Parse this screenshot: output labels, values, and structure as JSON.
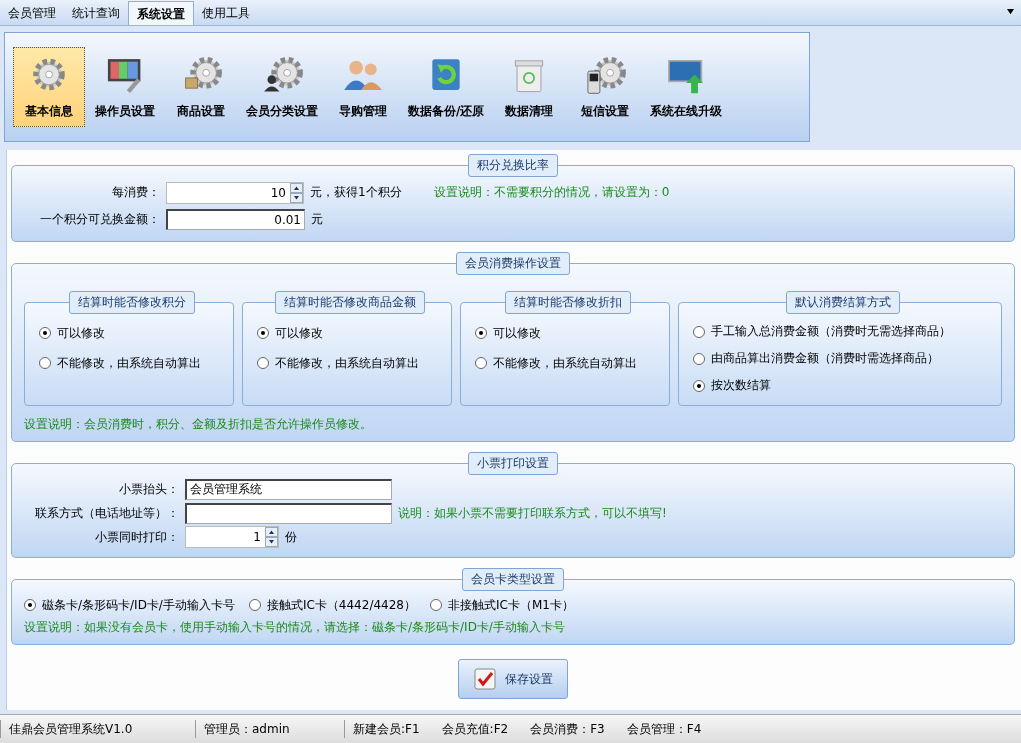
{
  "tabs": [
    {
      "label": "会员管理",
      "selected": false
    },
    {
      "label": "统计查询",
      "selected": false
    },
    {
      "label": "系统设置",
      "selected": true
    },
    {
      "label": "使用工具",
      "selected": false
    }
  ],
  "toolbar": [
    {
      "label": "基本信息",
      "selected": true
    },
    {
      "label": "操作员设置",
      "selected": false
    },
    {
      "label": "商品设置",
      "selected": false
    },
    {
      "label": "会员分类设置",
      "selected": false
    },
    {
      "label": "导购管理",
      "selected": false
    },
    {
      "label": "数据备份/还原",
      "selected": false
    },
    {
      "label": "数据清理",
      "selected": false
    },
    {
      "label": "短信设置",
      "selected": false
    },
    {
      "label": "系统在线升级",
      "selected": false
    }
  ],
  "points": {
    "title": "积分兑换比率",
    "spend_label": "每消费：",
    "spend_value": "10",
    "spend_suffix": "元，获得1个积分",
    "note": "设置说明：不需要积分的情况，请设置为：0",
    "exchange_label": "一个积分可兑换金额：",
    "exchange_value": "0.01",
    "exchange_suffix": "元"
  },
  "consume": {
    "title": "会员消费操作设置",
    "groups": [
      {
        "title": "结算时能否修改积分",
        "options": [
          {
            "label": "可以修改",
            "selected": true
          },
          {
            "label": "不能修改，由系统自动算出",
            "selected": false
          }
        ]
      },
      {
        "title": "结算时能否修改商品金额",
        "options": [
          {
            "label": "可以修改",
            "selected": true
          },
          {
            "label": "不能修改，由系统自动算出",
            "selected": false
          }
        ]
      },
      {
        "title": "结算时能否修改折扣",
        "options": [
          {
            "label": "可以修改",
            "selected": true
          },
          {
            "label": "不能修改，由系统自动算出",
            "selected": false
          }
        ]
      },
      {
        "title": "默认消费结算方式",
        "options": [
          {
            "label": "手工输入总消费金额（消费时无需选择商品）",
            "selected": false
          },
          {
            "label": "由商品算出消费金额（消费时需选择商品）",
            "selected": false
          },
          {
            "label": "按次数结算",
            "selected": true
          }
        ]
      }
    ],
    "note": "设置说明：会员消费时，积分、金额及折扣是否允许操作员修改。"
  },
  "receipt": {
    "title": "小票打印设置",
    "header_label": "小票抬头：",
    "header_value": "会员管理系统",
    "contact_label": "联系方式（电话地址等）：",
    "contact_note": "说明：如果小票不需要打印联系方式，可以不填写!",
    "copies_label": "小票同时打印：",
    "copies_value": "1",
    "copies_suffix": "份"
  },
  "card": {
    "title": "会员卡类型设置",
    "options": [
      {
        "label": "磁条卡/条形码卡/ID卡/手动输入卡号",
        "selected": true
      },
      {
        "label": "接触式IC卡（4442/4428）",
        "selected": false
      },
      {
        "label": "非接触式IC卡（M1卡）",
        "selected": false
      }
    ],
    "note": "设置说明：如果没有会员卡，使用手动输入卡号的情况，请选择：磁条卡/条形码卡/ID卡/手动输入卡号"
  },
  "save_button": "保存设置",
  "status_bar": [
    [
      "佳鼎会员管理系统V1.0"
    ],
    [
      "管理员：admin"
    ],
    [
      "新建会员:F1",
      "会员充值:F2",
      "会员消费：F3",
      "会员管理：F4"
    ]
  ]
}
